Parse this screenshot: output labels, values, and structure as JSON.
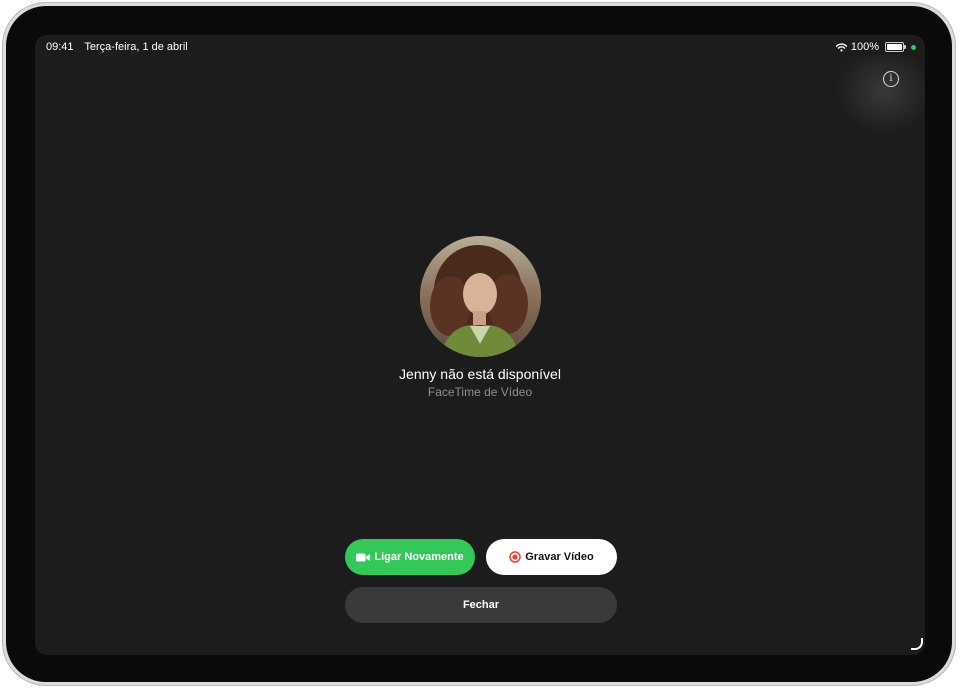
{
  "status_bar": {
    "time": "09:41",
    "date": "Terça-feira, 1 de abril",
    "battery": "100%",
    "icons": [
      "wifi-icon",
      "battery-icon",
      "camera-indicator-dot"
    ]
  },
  "info_button": {
    "icon": "info-icon",
    "glyph": "i"
  },
  "caller": {
    "name": "Jenny não está disponível",
    "call_type": "FaceTime de Vídeo"
  },
  "actions": {
    "call_again": {
      "label": "Ligar Novamente",
      "icon": "video-camera-icon"
    },
    "record_video": {
      "label": "Gravar Vídeo",
      "icon": "record-icon"
    },
    "close": {
      "label": "Fechar"
    }
  },
  "colors": {
    "accent_green": "#34c759",
    "record_red": "#ff3b30",
    "screen_background": "#1c1c1c",
    "secondary_button": "#3a3a3c"
  }
}
